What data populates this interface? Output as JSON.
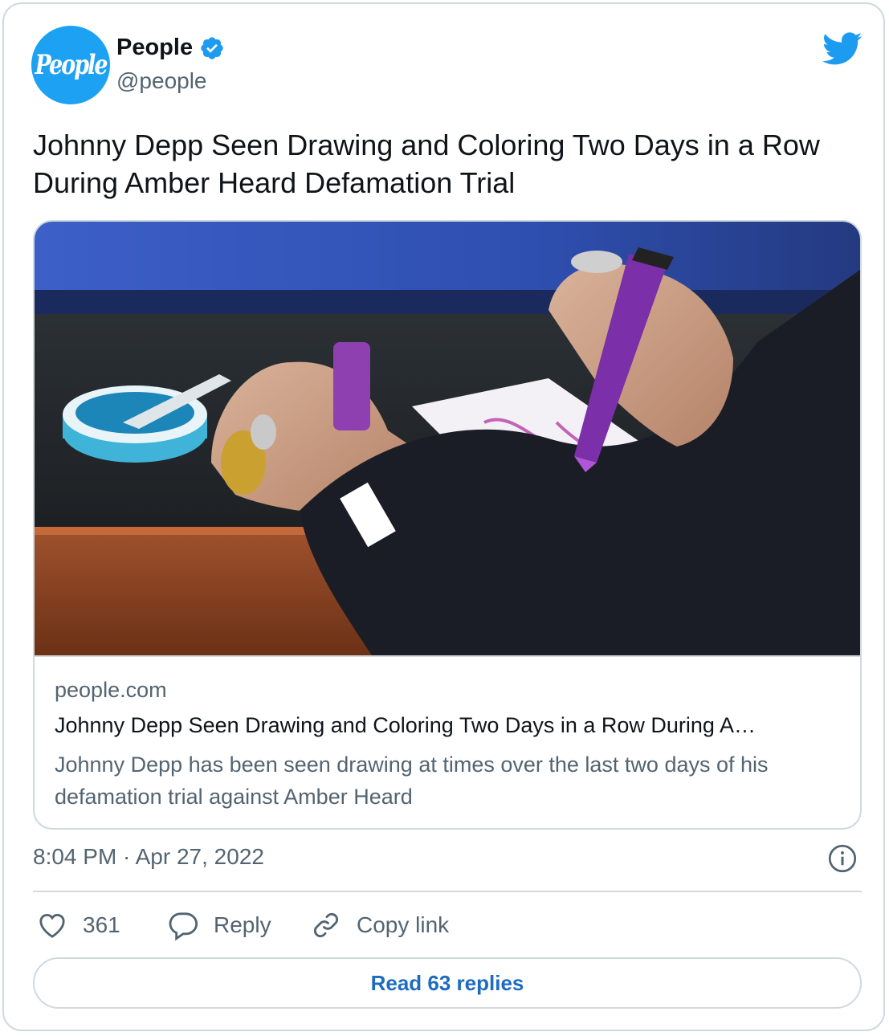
{
  "author": {
    "avatar_text": "People",
    "name": "People",
    "handle": "@people",
    "verified": true
  },
  "tweet": {
    "text": "Johnny Depp Seen Drawing and Coloring Two Days in a Row During Amber Heard Defamation Trial"
  },
  "link_card": {
    "domain": "people.com",
    "title": "Johnny Depp Seen Drawing and Coloring Two Days in a Row During A…",
    "description": "Johnny Depp has been seen drawing at times over the last two days of his defamation trial against Amber Heard"
  },
  "meta": {
    "timestamp": "8:04 PM · Apr 27, 2022"
  },
  "actions": {
    "like_count": "361",
    "reply_label": "Reply",
    "copy_label": "Copy link"
  },
  "read_replies_label": "Read 63 replies",
  "colors": {
    "twitter_blue": "#1d9bf0",
    "text_primary": "#0f1419",
    "text_secondary": "#536471",
    "border": "#cfd9de",
    "link_button": "#1d6cc0"
  },
  "icons": [
    "verified-badge-icon",
    "twitter-bird-icon",
    "info-icon",
    "heart-icon",
    "reply-bubble-icon",
    "link-icon"
  ]
}
